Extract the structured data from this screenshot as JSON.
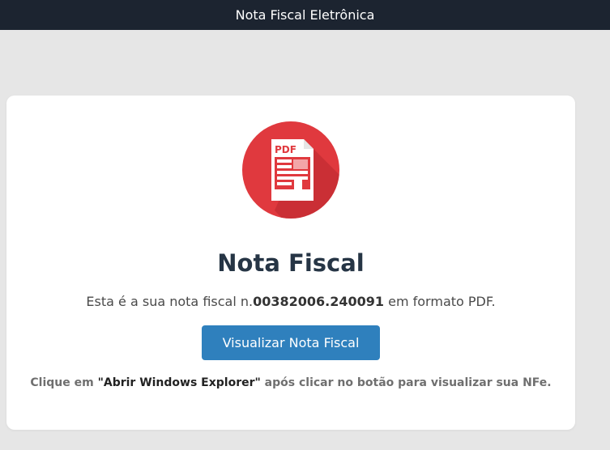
{
  "header": {
    "title": "Nota Fiscal Eletrônica"
  },
  "card": {
    "icon_label": "PDF",
    "title": "Nota Fiscal",
    "description_prefix": "Esta é a sua nota fiscal n.",
    "invoice_number": "00382006.240091",
    "description_suffix": " em formato PDF.",
    "button_label": "Visualizar Nota Fiscal",
    "hint_prefix": "Clique em ",
    "hint_emphasis": "\"Abrir Windows Explorer\"",
    "hint_suffix": " após clicar no botão para visualizar sua NFe."
  },
  "colors": {
    "header_bg": "#1c2430",
    "icon_circle": "#e0393e",
    "button_bg": "#2f80bd",
    "title_text": "#263545"
  }
}
